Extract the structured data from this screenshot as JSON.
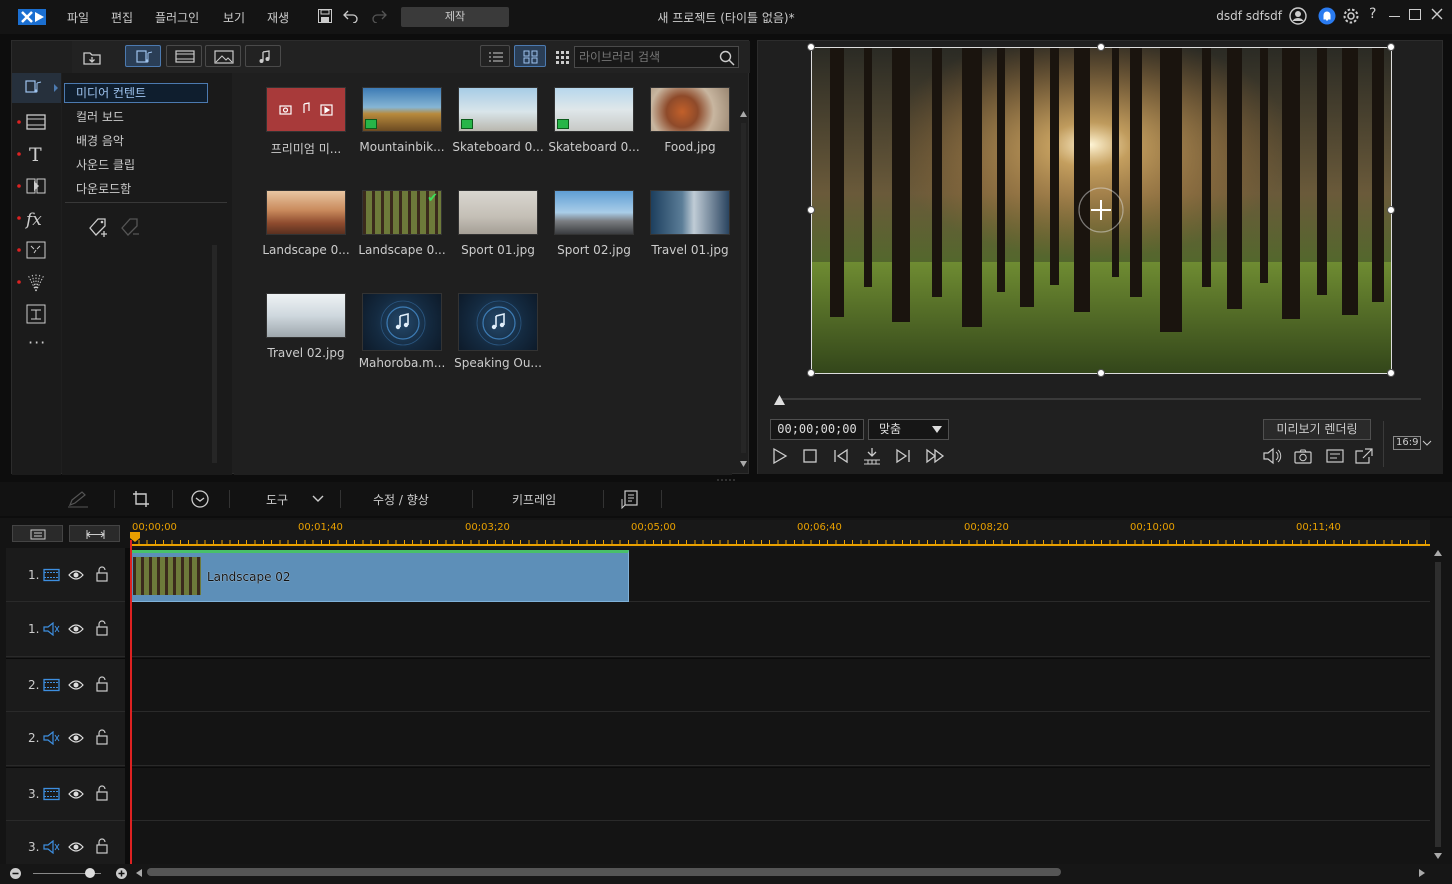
{
  "menu": {
    "file": "파일",
    "edit": "편집",
    "plugins": "플러그인",
    "view": "보기",
    "playback": "재생"
  },
  "produce_label": "제작",
  "window_title": "새 프로젝트 (타이틀 없음)*",
  "user_name": "dsdf sdfsdf",
  "library": {
    "search_placeholder": "라이브러리 검색",
    "categories": [
      "미디어 컨텐트",
      "컬러 보드",
      "배경 음악",
      "사운드 클립",
      "다운로드함"
    ],
    "items": [
      {
        "label": "프리미엄 미...",
        "type": "premium"
      },
      {
        "label": "Mountainbik...",
        "type": "video"
      },
      {
        "label": "Skateboard 0...",
        "type": "video"
      },
      {
        "label": "Skateboard 0...",
        "type": "video"
      },
      {
        "label": "Food.jpg",
        "type": "image"
      },
      {
        "label": "Landscape 0...",
        "type": "image"
      },
      {
        "label": "Landscape 0...",
        "type": "image",
        "in_use": true
      },
      {
        "label": "Sport 01.jpg",
        "type": "image"
      },
      {
        "label": "Sport 02.jpg",
        "type": "image"
      },
      {
        "label": "Travel 01.jpg",
        "type": "image"
      },
      {
        "label": "Travel 02.jpg",
        "type": "image"
      },
      {
        "label": "Mahoroba.m...",
        "type": "audio"
      },
      {
        "label": "Speaking Ou...",
        "type": "audio"
      }
    ]
  },
  "preview": {
    "timecode": "00;00;00;00",
    "fit_label": "맞춤",
    "render_label": "미리보기 렌더링",
    "aspect": "16:9"
  },
  "edit_toolbar": {
    "tools": "도구",
    "fix_enhance": "수정 / 향상",
    "keyframe": "키프레임"
  },
  "timeline": {
    "ticks": [
      "00;00;00",
      "00;01;40",
      "00;03;20",
      "00;05;00",
      "00;06;40",
      "00;08;20",
      "00;10;00",
      "00;11;40"
    ],
    "tracks": [
      {
        "label": "1.",
        "kind": "video"
      },
      {
        "label": "1.",
        "kind": "audio"
      },
      {
        "label": "2.",
        "kind": "video"
      },
      {
        "label": "2.",
        "kind": "audio"
      },
      {
        "label": "3.",
        "kind": "video"
      },
      {
        "label": "3.",
        "kind": "audio"
      }
    ],
    "clip_label": "Landscape 02"
  },
  "colors": {
    "accent": "#4c7ab0",
    "clip": "#5d8fb8",
    "playhead": "#dd2222",
    "ruler_text": "#e8a000"
  }
}
